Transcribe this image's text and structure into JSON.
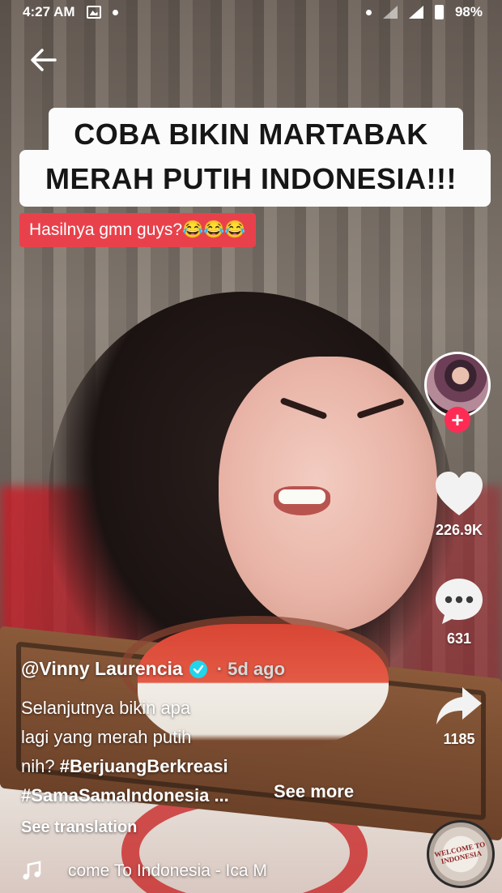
{
  "status_bar": {
    "time": "4:27 AM",
    "battery": "98%"
  },
  "overlay": {
    "title_line1": "COBA BIKIN MARTABAK",
    "title_line2": "MERAH PUTIH INDONESIA!!!",
    "subtitle": "Hasilnya gmn guys?😂😂😂"
  },
  "actions": {
    "likes": "226.9K",
    "comments": "631",
    "shares": "1185",
    "follow_symbol": "+"
  },
  "post": {
    "author": "@Vinny Laurencia",
    "posted": "· 5d ago",
    "desc_line1": "Selanjutnya bikin apa",
    "desc_line2": "lagi yang merah putih",
    "desc_line3_text": "nih? ",
    "desc_line3_tag": "#BerjuangBerkreasi",
    "desc_line4_tag": "#SamaSamaIndonesia ...",
    "see_more": "See more",
    "see_translation": "See translation",
    "music": "come To Indonesia - Ica M",
    "disc_text": "WELCOME TO INDONESIA"
  },
  "icons": [
    "back-arrow-icon",
    "image-icon",
    "heart-icon",
    "comment-icon",
    "share-icon",
    "music-note-icon",
    "verified-icon",
    "music-disc-icon"
  ]
}
